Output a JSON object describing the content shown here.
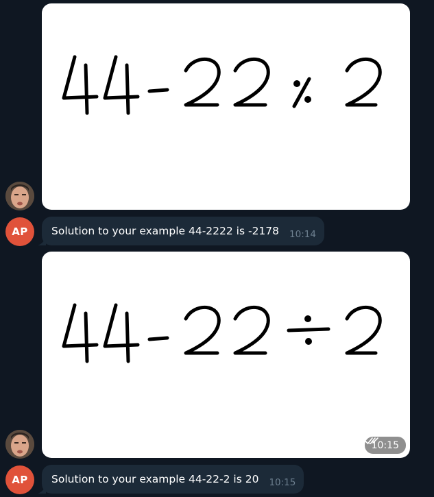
{
  "messages": [
    {
      "type": "image",
      "sender": "user",
      "handwriting": "44-22٪2",
      "avatar_icon": "user-photo-avatar"
    },
    {
      "type": "text",
      "sender": "AP",
      "text": "Solution to your example 44-2222 is -2178",
      "time": "10:14"
    },
    {
      "type": "image",
      "sender": "user",
      "handwriting": "44-22÷2",
      "time": "10:15",
      "status_icon": "double-check-icon",
      "avatar_icon": "user-photo-avatar"
    },
    {
      "type": "text",
      "sender": "AP",
      "text": "Solution to your example 44-22-2 is 20",
      "time": "10:15"
    }
  ],
  "bot": {
    "initials": "AP",
    "color": "#e0523a"
  },
  "colors": {
    "background": "#0f1722",
    "bubble": "#1c2a38",
    "timestamp": "#6d7f8f"
  }
}
